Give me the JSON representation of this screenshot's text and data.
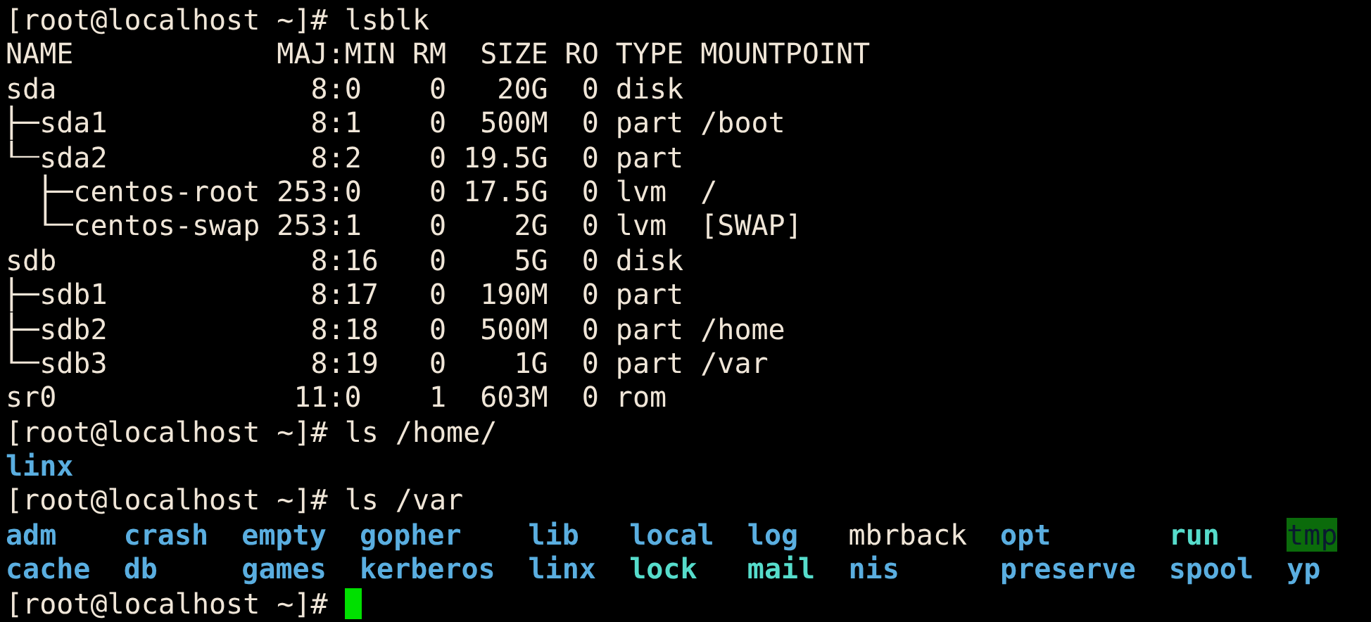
{
  "blocks": [
    {
      "kind": "command",
      "prompt": "[root@localhost ~]#",
      "command": "lsblk",
      "cursor": false
    },
    {
      "kind": "lsblk",
      "columns": [
        "NAME",
        "MAJ:MIN",
        "RM",
        "SIZE",
        "RO",
        "TYPE",
        "MOUNTPOINT"
      ],
      "devices": [
        {
          "name": "sda",
          "maj_min": "8:0",
          "rm": "0",
          "size": "20G",
          "ro": "0",
          "type": "disk",
          "children": [
            {
              "name": "sda1",
              "maj_min": "8:1",
              "rm": "0",
              "size": "500M",
              "ro": "0",
              "type": "part",
              "mountpoint": "/boot"
            },
            {
              "name": "sda2",
              "maj_min": "8:2",
              "rm": "0",
              "size": "19.5G",
              "ro": "0",
              "type": "part",
              "children": [
                {
                  "name": "centos-root",
                  "maj_min": "253:0",
                  "rm": "0",
                  "size": "17.5G",
                  "ro": "0",
                  "type": "lvm",
                  "mountpoint": "/"
                },
                {
                  "name": "centos-swap",
                  "maj_min": "253:1",
                  "rm": "0",
                  "size": "2G",
                  "ro": "0",
                  "type": "lvm",
                  "mountpoint": "[SWAP]"
                }
              ]
            }
          ]
        },
        {
          "name": "sdb",
          "maj_min": "8:16",
          "rm": "0",
          "size": "5G",
          "ro": "0",
          "type": "disk",
          "children": [
            {
              "name": "sdb1",
              "maj_min": "8:17",
              "rm": "0",
              "size": "190M",
              "ro": "0",
              "type": "part"
            },
            {
              "name": "sdb2",
              "maj_min": "8:18",
              "rm": "0",
              "size": "500M",
              "ro": "0",
              "type": "part",
              "mountpoint": "/home"
            },
            {
              "name": "sdb3",
              "maj_min": "8:19",
              "rm": "0",
              "size": "1G",
              "ro": "0",
              "type": "part",
              "mountpoint": "/var"
            }
          ]
        },
        {
          "name": "sr0",
          "maj_min": "11:0",
          "rm": "1",
          "size": "603M",
          "ro": "0",
          "type": "rom"
        }
      ]
    },
    {
      "kind": "command",
      "prompt": "[root@localhost ~]#",
      "command": "ls /home/",
      "cursor": false
    },
    {
      "kind": "ls",
      "rows": [
        [
          {
            "name": "linx",
            "kind": "dir"
          }
        ]
      ]
    },
    {
      "kind": "command",
      "prompt": "[root@localhost ~]#",
      "command": "ls /var",
      "cursor": false
    },
    {
      "kind": "ls",
      "rows": [
        [
          {
            "name": "adm",
            "kind": "dir"
          },
          {
            "name": "crash",
            "kind": "dir"
          },
          {
            "name": "empty",
            "kind": "dir"
          },
          {
            "name": "gopher",
            "kind": "dir"
          },
          {
            "name": "lib",
            "kind": "dir"
          },
          {
            "name": "local",
            "kind": "dir"
          },
          {
            "name": "log",
            "kind": "dir"
          },
          {
            "name": "mbrback",
            "kind": "file"
          },
          {
            "name": "opt",
            "kind": "dir"
          },
          {
            "name": "run",
            "kind": "link"
          },
          {
            "name": "tmp",
            "kind": "sticky"
          }
        ],
        [
          {
            "name": "cache",
            "kind": "dir"
          },
          {
            "name": "db",
            "kind": "dir"
          },
          {
            "name": "games",
            "kind": "dir"
          },
          {
            "name": "kerberos",
            "kind": "dir"
          },
          {
            "name": "linx",
            "kind": "dir"
          },
          {
            "name": "lock",
            "kind": "link"
          },
          {
            "name": "mail",
            "kind": "link"
          },
          {
            "name": "nis",
            "kind": "dir"
          },
          {
            "name": "preserve",
            "kind": "dir"
          },
          {
            "name": "spool",
            "kind": "dir"
          },
          {
            "name": "yp",
            "kind": "dir"
          }
        ]
      ]
    },
    {
      "kind": "command",
      "prompt": "[root@localhost ~]#",
      "cursor": true
    }
  ]
}
